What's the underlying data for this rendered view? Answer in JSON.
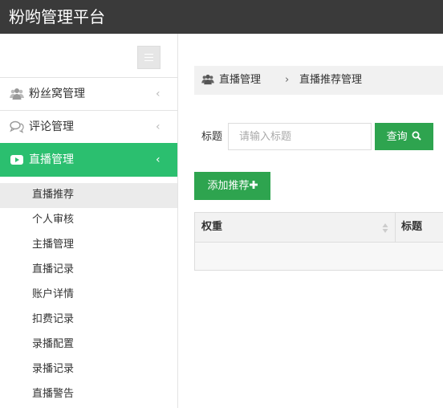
{
  "app": {
    "title": "粉哟管理平台"
  },
  "sidebar": {
    "menu": [
      {
        "label": "粉丝窝管理",
        "icon": "users-icon"
      },
      {
        "label": "评论管理",
        "icon": "comments-icon"
      },
      {
        "label": "直播管理",
        "icon": "youtube-play-icon"
      }
    ],
    "submenu": [
      "直播推荐",
      "个人审核",
      "主播管理",
      "直播记录",
      "账户详情",
      "扣费记录",
      "录播配置",
      "录播记录",
      "直播警告"
    ]
  },
  "breadcrumb": {
    "parent": "直播管理",
    "separator": "›",
    "current": "直播推荐管理"
  },
  "search": {
    "label": "标题",
    "placeholder": "请输入标题",
    "button_label": "查询"
  },
  "actions": {
    "add_label": "添加推荐"
  },
  "table": {
    "columns": [
      "权重",
      "标题"
    ]
  },
  "colors": {
    "topbar": "#3a3a3a",
    "accent": "#2bbf6f",
    "button": "#2ea44f"
  }
}
